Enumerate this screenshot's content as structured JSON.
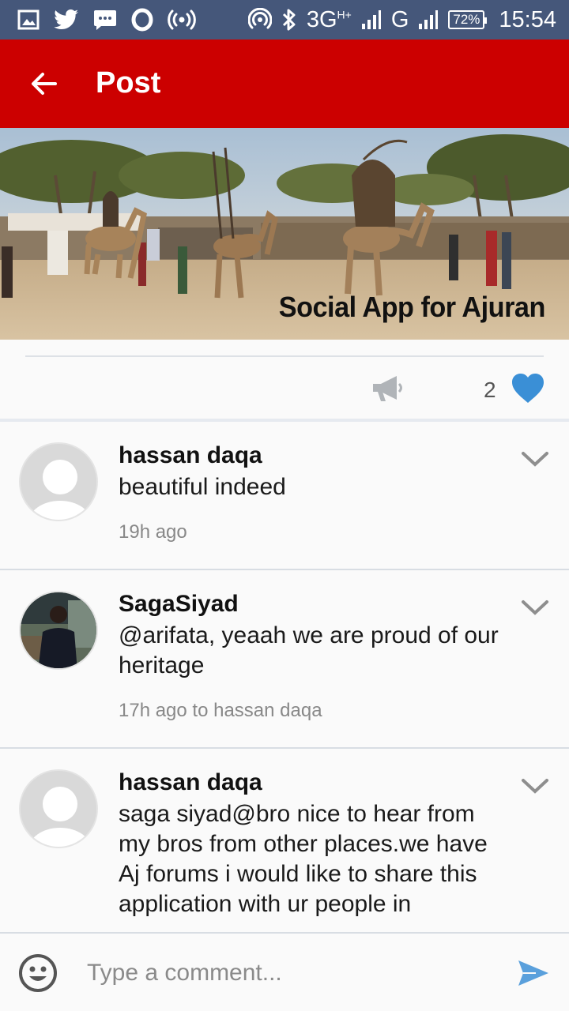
{
  "status_bar": {
    "network_label": "3G",
    "network_sup": "H+",
    "network2_label": "G",
    "battery": "72%",
    "time": "15:54",
    "icons": [
      "image-icon",
      "twitter-icon",
      "message-icon",
      "opera-icon",
      "wireless-icon",
      "hotspot-icon",
      "bluetooth-icon",
      "signal-icon"
    ]
  },
  "app_bar": {
    "title": "Post",
    "color": "#cc0000"
  },
  "banner": {
    "caption": "Social App for Ajuran"
  },
  "actions": {
    "like_count": "2",
    "heart_color": "#3a8fd6"
  },
  "comments": [
    {
      "author": "hassan daqa",
      "text": "beautiful indeed",
      "time": "19h ago",
      "avatar": "placeholder"
    },
    {
      "author": "SagaSiyad",
      "text": "@arifata, yeaah we are proud of our heritage",
      "time": "17h ago to hassan daqa",
      "avatar": "photo"
    },
    {
      "author": "hassan daqa",
      "text": "saga siyad@bro nice to hear from my bros from other places.we have Aj forums i would like to share this application with ur people in",
      "time": "",
      "avatar": "placeholder"
    }
  ],
  "composer": {
    "placeholder": "Type a comment...",
    "send_color": "#5aa0dc"
  }
}
